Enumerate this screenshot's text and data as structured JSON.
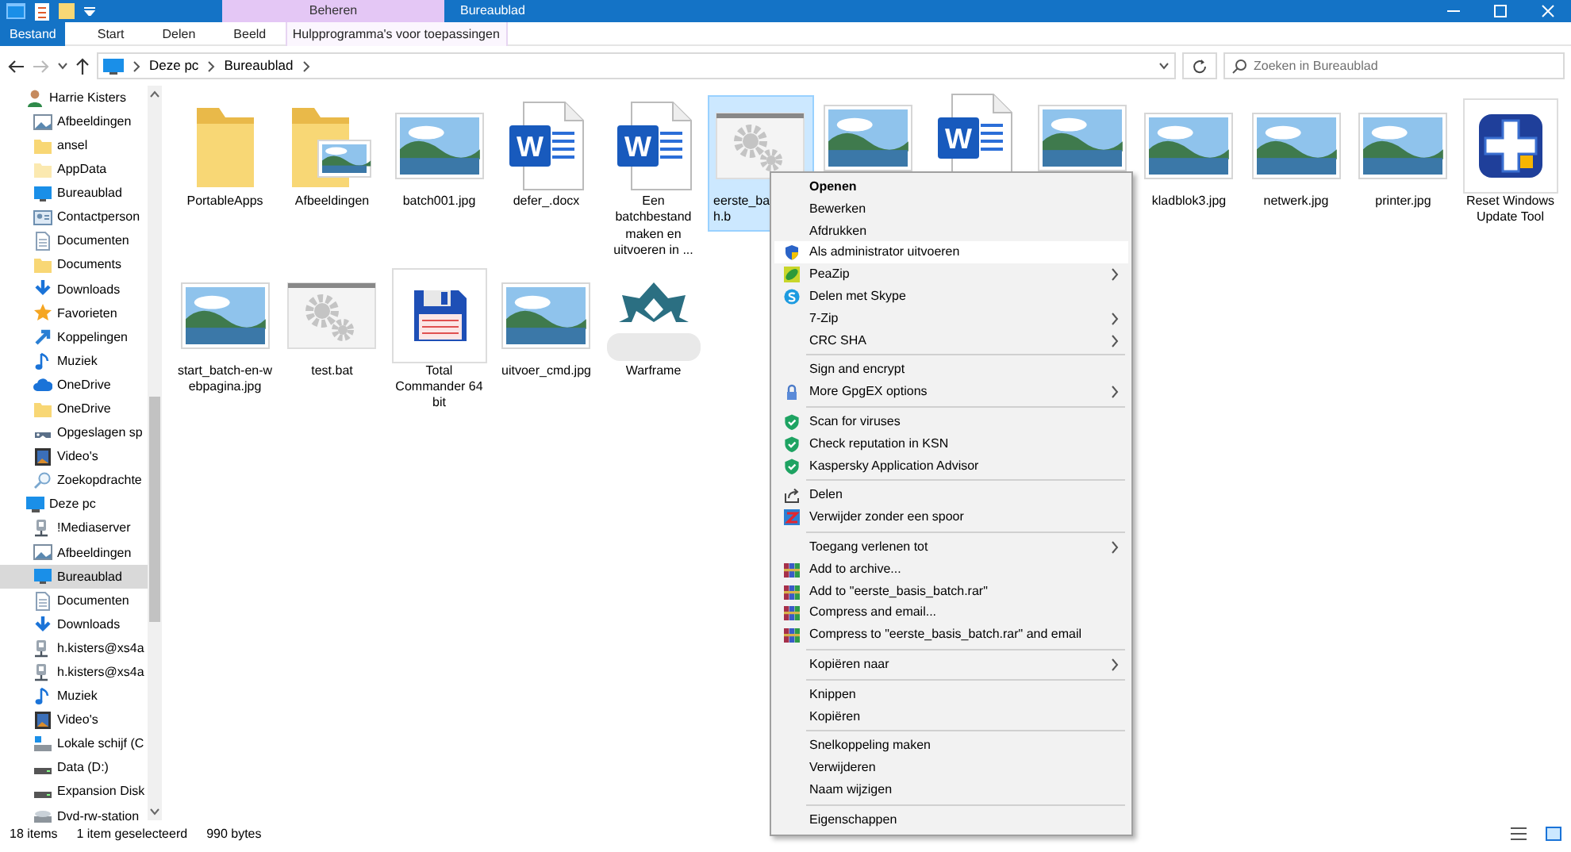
{
  "window": {
    "context_header": "Beheren",
    "title": "Bureaublad"
  },
  "ribbon_tabs": [
    {
      "label": "Bestand",
      "kind": "file"
    },
    {
      "label": "Start",
      "kind": "tab"
    },
    {
      "label": "Delen",
      "kind": "tab"
    },
    {
      "label": "Beeld",
      "kind": "tab"
    },
    {
      "label": "Hulpprogramma's voor toepassingen",
      "kind": "contextual"
    }
  ],
  "address": {
    "crumbs": [
      "Deze pc",
      "Bureaublad"
    ],
    "search_placeholder": "Zoeken in Bureaublad"
  },
  "sidebar": {
    "items": [
      {
        "label": "Harrie Kisters",
        "kind": "user",
        "selected": false,
        "children": [
          {
            "label": "Afbeeldingen",
            "kind": "pictures",
            "selected": false
          },
          {
            "label": "ansel",
            "kind": "folder",
            "selected": false
          },
          {
            "label": "AppData",
            "kind": "folder-light",
            "selected": false
          },
          {
            "label": "Bureaublad",
            "kind": "desktop",
            "selected": false
          },
          {
            "label": "Contactperson",
            "kind": "contacts",
            "selected": false
          },
          {
            "label": "Documenten",
            "kind": "document",
            "selected": false
          },
          {
            "label": "Documents",
            "kind": "folder",
            "selected": false
          },
          {
            "label": "Downloads",
            "kind": "download",
            "selected": false
          },
          {
            "label": "Favorieten",
            "kind": "star",
            "selected": false
          },
          {
            "label": "Koppelingen",
            "kind": "link",
            "selected": false
          },
          {
            "label": "Muziek",
            "kind": "music",
            "selected": false
          },
          {
            "label": "OneDrive",
            "kind": "cloud",
            "selected": false
          },
          {
            "label": "OneDrive",
            "kind": "folder",
            "selected": false
          },
          {
            "label": "Opgeslagen sp",
            "kind": "gamepad",
            "selected": false
          },
          {
            "label": "Video's",
            "kind": "video",
            "selected": false
          },
          {
            "label": "Zoekopdrachte",
            "kind": "search",
            "selected": false
          }
        ]
      },
      {
        "label": "Deze pc",
        "kind": "pc",
        "selected": false,
        "children": [
          {
            "label": "!Mediaserver",
            "kind": "network-drive",
            "selected": false
          },
          {
            "label": "Afbeeldingen",
            "kind": "pictures",
            "selected": false
          },
          {
            "label": "Bureaublad",
            "kind": "desktop",
            "selected": true
          },
          {
            "label": "Documenten",
            "kind": "document",
            "selected": false
          },
          {
            "label": "Downloads",
            "kind": "download",
            "selected": false
          },
          {
            "label": "h.kisters@xs4a",
            "kind": "network-drive",
            "selected": false
          },
          {
            "label": "h.kisters@xs4a",
            "kind": "network-drive",
            "selected": false
          },
          {
            "label": "Muziek",
            "kind": "music",
            "selected": false
          },
          {
            "label": "Video's",
            "kind": "video",
            "selected": false
          },
          {
            "label": "Lokale schijf (C",
            "kind": "system-drive",
            "selected": false
          },
          {
            "label": "Data (D:)",
            "kind": "drive",
            "selected": false
          },
          {
            "label": "Expansion Disk",
            "kind": "drive",
            "selected": false
          },
          {
            "label": "Dvd-rw-station",
            "kind": "optical",
            "selected": false
          }
        ]
      }
    ]
  },
  "files": [
    {
      "lines": [
        "PortableApps"
      ],
      "kind": "folder",
      "selected": false
    },
    {
      "lines": [
        "Afbeeldingen"
      ],
      "kind": "folder-pictures",
      "selected": false
    },
    {
      "lines": [
        "batch001.jpg"
      ],
      "kind": "image",
      "selected": false
    },
    {
      "lines": [
        "defer_.docx"
      ],
      "kind": "word",
      "icon_text": "W",
      "selected": false
    },
    {
      "lines": [
        "Een",
        "batchbestand",
        "maken en",
        "uitvoeren in ..."
      ],
      "kind": "word",
      "icon_text": "W",
      "selected": false
    },
    {
      "lines": [
        "eerste_ba",
        "h.b"
      ],
      "kind": "gears",
      "selected": true,
      "covered": true
    },
    {
      "kind": "image",
      "selected": false
    },
    {
      "kind": "word",
      "icon_text": "W",
      "selected": false
    },
    {
      "kind": "image",
      "selected": false
    },
    {
      "lines": [
        "kladblok3.jpg"
      ],
      "kind": "image",
      "selected": false
    },
    {
      "lines": [
        "netwerk.jpg"
      ],
      "kind": "image",
      "selected": false
    },
    {
      "lines": [
        "printer.jpg"
      ],
      "kind": "image",
      "selected": false
    },
    {
      "lines": [
        "Reset Windows",
        "Update Tool"
      ],
      "kind": "cross-app",
      "selected": false
    },
    {
      "lines": [
        "start_batch-en-w",
        "ebpagina.jpg"
      ],
      "kind": "image",
      "selected": false
    },
    {
      "lines": [
        "test.bat"
      ],
      "kind": "gears",
      "selected": false
    },
    {
      "lines": [
        "Total",
        "Commander 64",
        "bit"
      ],
      "kind": "floppy",
      "selected": false
    },
    {
      "lines": [
        "uitvoer_cmd.jpg"
      ],
      "kind": "image",
      "selected": false
    },
    {
      "lines": [
        "Warframe"
      ],
      "kind": "emblem",
      "selected": false
    }
  ],
  "context_menu": [
    {
      "kind": "plain",
      "label": "Openen",
      "default": true
    },
    {
      "kind": "plain",
      "label": "Bewerken"
    },
    {
      "kind": "plain",
      "label": "Afdrukken"
    },
    {
      "kind": "shield",
      "label": "Als administrator uitvoeren",
      "hovered": true
    },
    {
      "kind": "leaf",
      "label": "PeaZip",
      "submenu": true
    },
    {
      "kind": "skype",
      "label": "Delen met Skype"
    },
    {
      "kind": "plain",
      "label": "7-Zip",
      "submenu": true
    },
    {
      "kind": "plain",
      "label": "CRC SHA",
      "submenu": true
    },
    {
      "kind": "separator"
    },
    {
      "kind": "plain",
      "label": "Sign and encrypt"
    },
    {
      "kind": "lock",
      "label": "More GpgEX options",
      "submenu": true
    },
    {
      "kind": "separator"
    },
    {
      "kind": "green-shield",
      "label": "Scan for viruses"
    },
    {
      "kind": "green-shield",
      "label": "Check reputation in KSN"
    },
    {
      "kind": "green-shield",
      "label": "Kaspersky Application Advisor"
    },
    {
      "kind": "separator"
    },
    {
      "kind": "share",
      "label": "Delen"
    },
    {
      "kind": "eraser",
      "label": "Verwijder zonder een spoor"
    },
    {
      "kind": "separator"
    },
    {
      "kind": "plain",
      "label": "Toegang verlenen tot",
      "submenu": true
    },
    {
      "kind": "books",
      "label": "Add to archive..."
    },
    {
      "kind": "books",
      "label": "Add to \"eerste_basis_batch.rar\""
    },
    {
      "kind": "books",
      "label": "Compress and email..."
    },
    {
      "kind": "books",
      "label": "Compress to \"eerste_basis_batch.rar\" and email"
    },
    {
      "kind": "separator"
    },
    {
      "kind": "plain",
      "label": "Kopiëren naar",
      "submenu": true
    },
    {
      "kind": "separator"
    },
    {
      "kind": "plain",
      "label": "Knippen"
    },
    {
      "kind": "plain",
      "label": "Kopiëren"
    },
    {
      "kind": "separator"
    },
    {
      "kind": "plain",
      "label": "Snelkoppeling maken"
    },
    {
      "kind": "plain",
      "label": "Verwijderen"
    },
    {
      "kind": "plain",
      "label": "Naam wijzigen"
    },
    {
      "kind": "separator"
    },
    {
      "kind": "plain",
      "label": "Eigenschappen"
    }
  ],
  "status_bar": {
    "item_count": "18 items",
    "selection": "1 item geselecteerd",
    "size": "990 bytes"
  }
}
